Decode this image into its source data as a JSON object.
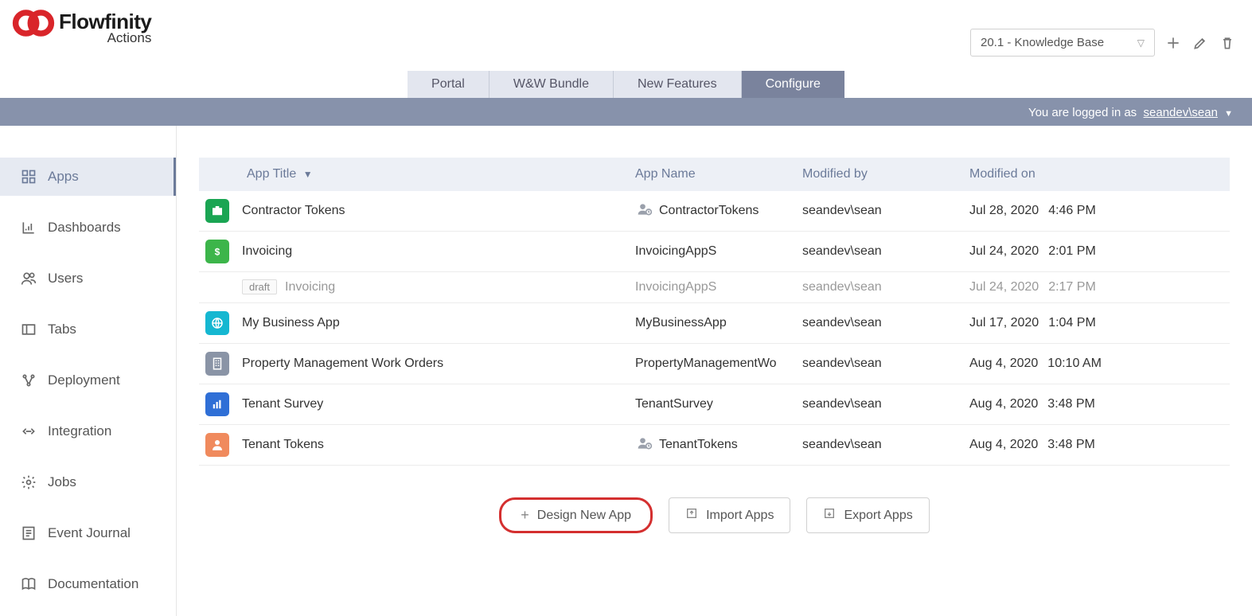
{
  "header": {
    "brand": "Flowfinity",
    "subtitle": "Actions",
    "kb_selector": "20.1 - Knowledge Base"
  },
  "tabs": [
    {
      "label": "Portal"
    },
    {
      "label": "W&W Bundle"
    },
    {
      "label": "New Features"
    },
    {
      "label": "Configure"
    }
  ],
  "loginbar": {
    "prefix": "You are logged in as",
    "user": "seandev\\sean"
  },
  "sidebar": [
    {
      "label": "Apps",
      "icon": "grid"
    },
    {
      "label": "Dashboards",
      "icon": "chart"
    },
    {
      "label": "Users",
      "icon": "users"
    },
    {
      "label": "Tabs",
      "icon": "tabs"
    },
    {
      "label": "Deployment",
      "icon": "deploy"
    },
    {
      "label": "Integration",
      "icon": "integration"
    },
    {
      "label": "Jobs",
      "icon": "gear"
    },
    {
      "label": "Event Journal",
      "icon": "journal"
    },
    {
      "label": "Documentation",
      "icon": "book"
    }
  ],
  "table": {
    "headers": {
      "title": "App Title",
      "name": "App Name",
      "modby": "Modified by",
      "modon": "Modified on"
    },
    "rows": [
      {
        "icon": "briefcase",
        "icon_color": "#1aa553",
        "title": "Contractor Tokens",
        "role_icon": true,
        "name": "ContractorTokens",
        "modby": "seandev\\sean",
        "date": "Jul 28, 2020",
        "time": "4:46 PM",
        "draft": false
      },
      {
        "icon": "dollar",
        "icon_color": "#3cb54a",
        "title": "Invoicing",
        "role_icon": false,
        "name": "InvoicingAppS",
        "modby": "seandev\\sean",
        "date": "Jul 24, 2020",
        "time": "2:01 PM",
        "draft": false
      },
      {
        "icon": "",
        "icon_color": "",
        "title": "Invoicing",
        "role_icon": false,
        "name": "InvoicingAppS",
        "modby": "seandev\\sean",
        "date": "Jul 24, 2020",
        "time": "2:17 PM",
        "draft": true,
        "draft_label": "draft"
      },
      {
        "icon": "globe",
        "icon_color": "#15b7d1",
        "title": "My Business App",
        "role_icon": false,
        "name": "MyBusinessApp",
        "modby": "seandev\\sean",
        "date": "Jul 17, 2020",
        "time": "1:04 PM",
        "draft": false
      },
      {
        "icon": "building",
        "icon_color": "#8a94a6",
        "title": "Property Management Work Orders",
        "role_icon": false,
        "name": "PropertyManagementWo",
        "modby": "seandev\\sean",
        "date": "Aug 4, 2020",
        "time": "10:10 AM",
        "draft": false
      },
      {
        "icon": "bars",
        "icon_color": "#2f6fd6",
        "title": "Tenant Survey",
        "role_icon": false,
        "name": "TenantSurvey",
        "modby": "seandev\\sean",
        "date": "Aug 4, 2020",
        "time": "3:48 PM",
        "draft": false
      },
      {
        "icon": "person",
        "icon_color": "#f08a5d",
        "title": "Tenant Tokens",
        "role_icon": true,
        "name": "TenantTokens",
        "modby": "seandev\\sean",
        "date": "Aug 4, 2020",
        "time": "3:48 PM",
        "draft": false
      }
    ]
  },
  "actions": {
    "design": "Design New App",
    "import": "Import Apps",
    "export": "Export Apps"
  }
}
